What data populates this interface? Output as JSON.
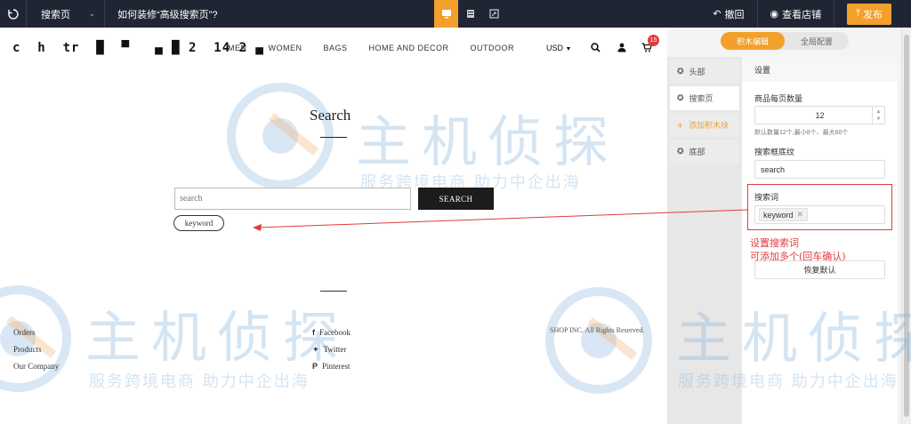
{
  "topbar": {
    "page_select": "搜索页",
    "tip": "如何装修“高级搜索页”?",
    "undo_label": "撤回",
    "view_store_label": "查看店铺",
    "publish_label": "发布"
  },
  "store": {
    "logo_text": "c  h  tr  █  ▀   ▄ █ 2  14 2 ▄",
    "nav": [
      "MEN",
      "WOMEN",
      "BAGS",
      "HOME AND DECOR",
      "OUTDOOR"
    ],
    "currency": "USD",
    "cart_count": "15",
    "search_title": "Search",
    "search_placeholder": "search",
    "search_button": "SEARCH",
    "keyword": "keyword",
    "footer_links": [
      "Orders",
      "Products",
      "Our Company"
    ],
    "social_links": [
      "Facebook",
      "Twitter",
      "Pinterest"
    ],
    "copyright": "SHOP INC. All Rights Reserved."
  },
  "panel": {
    "tabs": [
      "积木编辑",
      "全局配置"
    ],
    "side_items": [
      "头部",
      "搜索页",
      "添加积木块",
      "底部"
    ],
    "section_title": "设置",
    "per_page_label": "商品每页数量",
    "per_page_value": "12",
    "per_page_hint": "默认数量12个,最小8个、最大60个",
    "heading_label": "搜索框底纹",
    "heading_value": "search",
    "keywords_label": "搜索词",
    "keyword_tag": "keyword",
    "reset_label": "恢复默认"
  },
  "annotation": {
    "line1": "设置搜索词",
    "line2": "可添加多个(回车确认)"
  },
  "watermark": {
    "main": "主机侦探",
    "sub": "服务跨境电商 助力中企出海"
  },
  "colors": {
    "topbar": "#1f2533",
    "accent": "#f2a02b",
    "annotation": "#e23b3b"
  }
}
